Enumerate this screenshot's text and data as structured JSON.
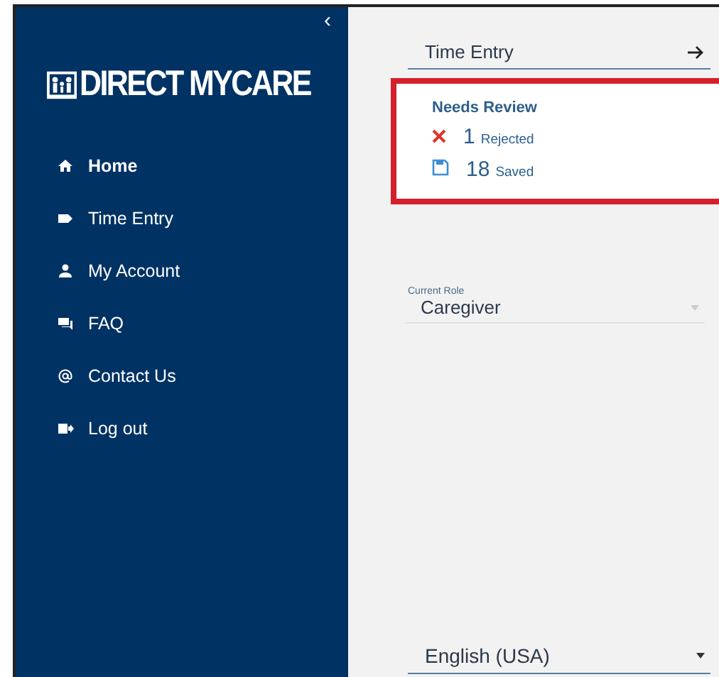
{
  "sidebar": {
    "collapse_glyph": "‹",
    "logo": "DIRECT MYCARE",
    "items": [
      {
        "label": "Home",
        "selected": true
      },
      {
        "label": "Time Entry",
        "selected": false
      },
      {
        "label": "My Account",
        "selected": false
      },
      {
        "label": "FAQ",
        "selected": false
      },
      {
        "label": "Contact Us",
        "selected": false
      },
      {
        "label": "Log out",
        "selected": false
      }
    ]
  },
  "main": {
    "time_entry": {
      "label": "Time Entry"
    },
    "needs_review": {
      "title": "Needs Review",
      "rows": [
        {
          "kind": "rejected",
          "count": "1",
          "label": "Rejected"
        },
        {
          "kind": "saved",
          "count": "18",
          "label": "Saved"
        }
      ]
    },
    "current_role": {
      "label": "Current Role",
      "value": "Caregiver"
    },
    "language": {
      "value": "English (USA)"
    }
  }
}
